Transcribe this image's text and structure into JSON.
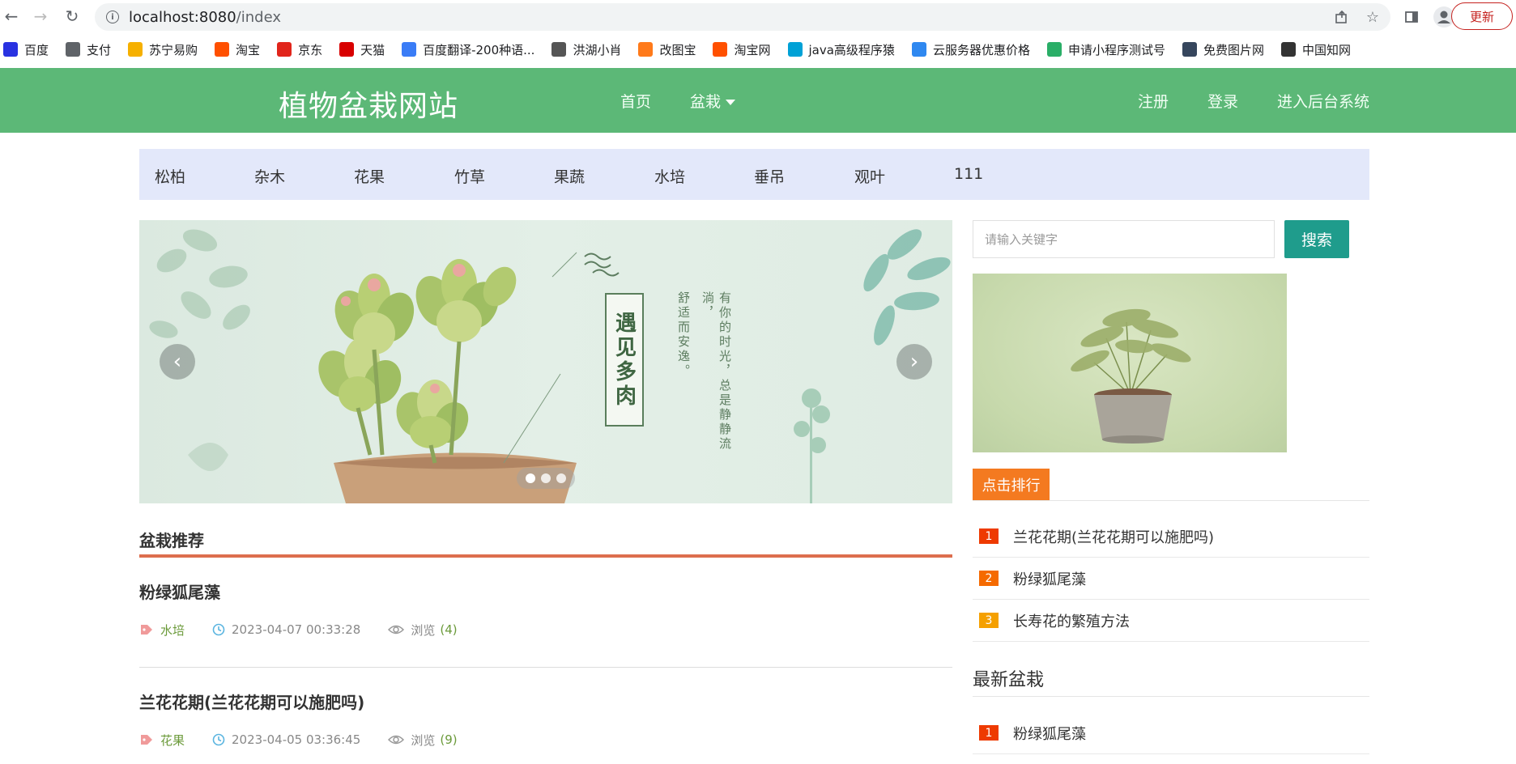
{
  "browser": {
    "url_host": "localhost:8080",
    "url_path": "/index",
    "update_label": "更新"
  },
  "bookmarks": [
    {
      "label": "百度",
      "icon": "baidu-icon",
      "color": "#2932e1"
    },
    {
      "label": "支付",
      "icon": "globe-icon",
      "color": "#5f6368"
    },
    {
      "label": "苏宁易购",
      "icon": "suning-icon",
      "color": "#f6b000"
    },
    {
      "label": "淘宝",
      "icon": "taobao-icon",
      "color": "#ff5000"
    },
    {
      "label": "京东",
      "icon": "jd-icon",
      "color": "#e1251b"
    },
    {
      "label": "天猫",
      "icon": "tmall-icon",
      "color": "#d80000"
    },
    {
      "label": "百度翻译-200种语...",
      "icon": "translate-icon",
      "color": "#3a7cf6"
    },
    {
      "label": "洪湖小肖",
      "icon": "bird-icon",
      "color": "#555555"
    },
    {
      "label": "改图宝",
      "icon": "gaitubao-icon",
      "color": "#ff7a1a"
    },
    {
      "label": "淘宝网",
      "icon": "taobao-icon",
      "color": "#ff5000"
    },
    {
      "label": "java高级程序猿",
      "icon": "bilibili-icon",
      "color": "#00a1d6"
    },
    {
      "label": "云服务器优惠价格",
      "icon": "cloud-icon",
      "color": "#2f88f0"
    },
    {
      "label": "申请小程序测试号",
      "icon": "wechat-icon",
      "color": "#2aae67"
    },
    {
      "label": "免费图片网",
      "icon": "tumblr-icon",
      "color": "#36465d"
    },
    {
      "label": "中国知网",
      "icon": "cnki-icon",
      "color": "#333333"
    }
  ],
  "header": {
    "logo": "植物盆栽网站",
    "nav": {
      "home": "首页",
      "bonsai": "盆栽"
    },
    "right": {
      "register": "注册",
      "login": "登录",
      "admin": "进入后台系统"
    },
    "color": "#5cb877"
  },
  "categories": [
    "松柏",
    "杂木",
    "花果",
    "竹草",
    "果蔬",
    "水培",
    "垂吊",
    "观叶",
    "111"
  ],
  "carousel": {
    "title": "遇见多肉",
    "poem_line1": "有你的时光，总是静静流淌，",
    "poem_line2": "舒适而安逸。",
    "slides": 3,
    "active_slide": 1
  },
  "recommend": {
    "title": "盆栽推荐",
    "posts": [
      {
        "title": "粉绿狐尾藻",
        "category": "水培",
        "date": "2023-04-07 00:33:28",
        "views_label": "浏览",
        "views": "(4)"
      },
      {
        "title": "兰花花期(兰花花期可以施肥吗)",
        "category": "花果",
        "date": "2023-04-05 03:36:45",
        "views_label": "浏览",
        "views": "(9)"
      }
    ]
  },
  "search": {
    "placeholder": "请输入关键字",
    "button": "搜索"
  },
  "ranking": {
    "title": "点击排行",
    "items": [
      {
        "num": "1",
        "text": "兰花花期(兰花花期可以施肥吗)",
        "color": "#ee3a00"
      },
      {
        "num": "2",
        "text": "粉绿狐尾藻",
        "color": "#f56a00"
      },
      {
        "num": "3",
        "text": "长寿花的繁殖方法",
        "color": "#f5a000"
      }
    ]
  },
  "latest": {
    "title": "最新盆栽",
    "items": [
      {
        "num": "1",
        "text": "粉绿狐尾藻",
        "color": "#ee3a00"
      }
    ]
  }
}
